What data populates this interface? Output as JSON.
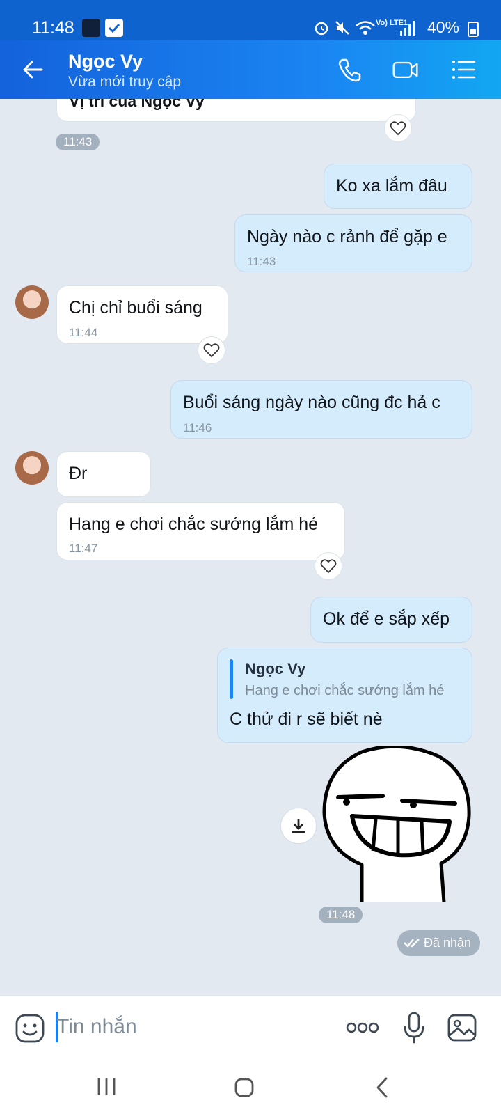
{
  "status": {
    "time": "11:48",
    "battery": "40%",
    "network": "Vo) LTE1"
  },
  "header": {
    "title": "Ngọc Vy",
    "subtitle": "Vừa mới truy cập",
    "icons": [
      "back-arrow-icon",
      "phone-icon",
      "video-call-icon",
      "menu-icon"
    ]
  },
  "messages": {
    "location_title": "Vị trí của Ngọc Vy",
    "time_1143": "11:43",
    "m1": {
      "text": "Ko xa lắm đâu"
    },
    "m2": {
      "text": "Ngày nào c rảnh để gặp e",
      "time": "11:43"
    },
    "m3": {
      "text": "Chị chỉ buổi sáng",
      "time": "11:44"
    },
    "m4": {
      "text": "Buổi sáng ngày nào cũng đc hả c",
      "time": "11:46"
    },
    "m5": {
      "text": "Đr"
    },
    "m6": {
      "text": "Hang e chơi chắc sướng lắm hé",
      "time": "11:47"
    },
    "m7": {
      "text": "Ok để e sắp xếp"
    },
    "m8": {
      "quote_name": "Ngọc Vy",
      "quote_text": "Hang e chơi chắc sướng lắm hé",
      "text": "C thử đi r sẽ biết nè"
    },
    "sticker_time": "11:48",
    "received": "Đã nhận"
  },
  "composer": {
    "placeholder": "Tin nhắn",
    "icons": [
      "emoji-icon",
      "more-icon",
      "microphone-icon",
      "image-icon"
    ]
  },
  "nav": {
    "icons": [
      "recent-apps-icon",
      "home-icon",
      "back-icon"
    ]
  },
  "colors": {
    "header_start": "#1462dc",
    "header_end": "#12a7f2",
    "outgoing_bubble": "#d5ecfd",
    "accent": "#1a80f0"
  }
}
